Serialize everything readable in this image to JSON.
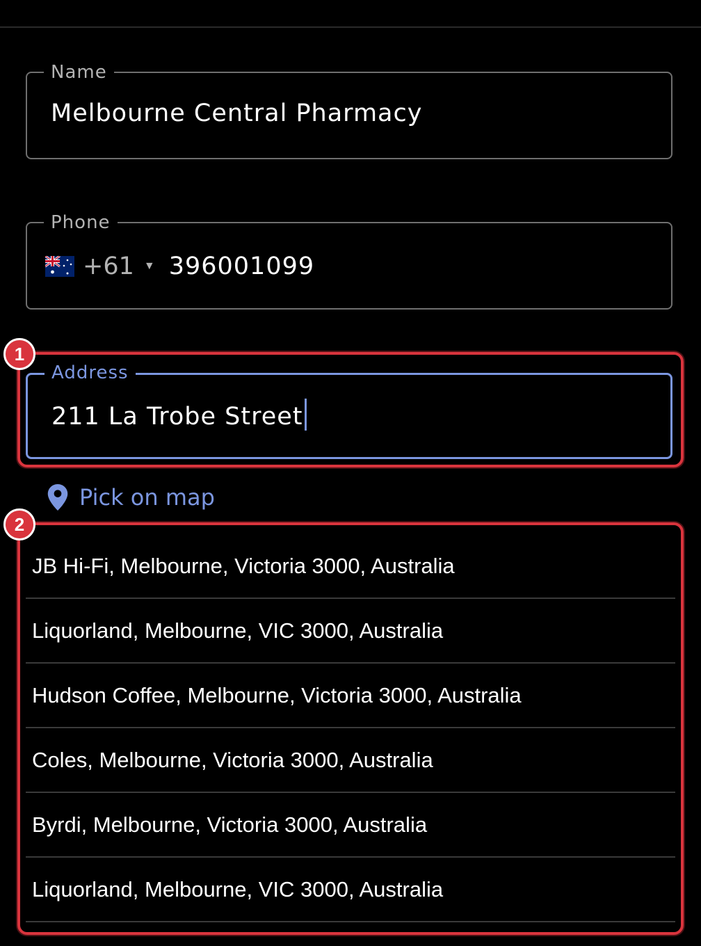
{
  "form": {
    "name": {
      "label": "Name",
      "value": "Melbourne Central Pharmacy"
    },
    "phone": {
      "label": "Phone",
      "country_flag": "australia-flag",
      "dial_code": "+61",
      "value": "396001099"
    },
    "address": {
      "label": "Address",
      "value": "211 La Trobe Street"
    },
    "pick_on_map": {
      "label": "Pick on map",
      "icon": "location-pin-icon"
    }
  },
  "suggestions": [
    "JB Hi-Fi, Melbourne, Victoria 3000, Australia",
    "Liquorland, Melbourne, VIC 3000, Australia",
    "Hudson Coffee, Melbourne, Victoria 3000, Australia",
    "Coles, Melbourne, Victoria 3000, Australia",
    "Byrdi, Melbourne, Victoria 3000, Australia",
    "Liquorland, Melbourne, VIC 3000, Australia"
  ],
  "annotations": [
    {
      "number": "1",
      "target": "address-field"
    },
    {
      "number": "2",
      "target": "suggestion-list"
    }
  ],
  "colors": {
    "background": "#000000",
    "accent": "#7b96e0",
    "highlight": "#d9343d",
    "outline": "#6f6f6f"
  }
}
